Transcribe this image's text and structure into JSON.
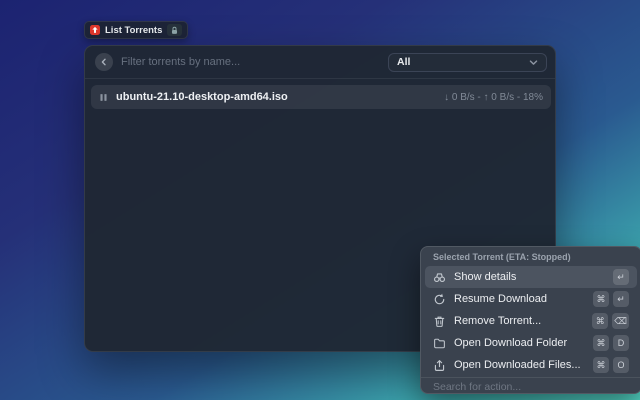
{
  "colors": {
    "background_gradient": [
      "#1c2371",
      "#253078",
      "#2a5a90",
      "#54dac9"
    ],
    "window_bg": "#1f2734",
    "action_panel_bg": "#3a424e",
    "selected_action_bg": "#4c5460",
    "row_highlight": "#343c4b",
    "app_icon_red": "#e0382d"
  },
  "command_badge": {
    "label": "List Torrents",
    "app_icon": "transmission-icon",
    "lock_icon": "lock-icon"
  },
  "window": {
    "header": {
      "back_icon": "chevron-left-icon",
      "filter_placeholder": "Filter torrents by name...",
      "status_dropdown": {
        "value": "All",
        "chevron_icon": "chevron-down-icon"
      }
    },
    "torrent_row": {
      "status_icon": "pause-icon",
      "name": "ubuntu-21.10-desktop-amd64.iso",
      "stats": "↓ 0 B/s - ↑ 0 B/s - 18%",
      "download_speed": "0 B/s",
      "upload_speed": "0 B/s",
      "progress": "18%"
    }
  },
  "action_panel": {
    "title": "Selected Torrent (ETA: Stopped)",
    "items": [
      {
        "icon": "binoculars-icon",
        "label": "Show details",
        "shortcuts": [
          "↵"
        ],
        "selected": true
      },
      {
        "icon": "resume-icon",
        "label": "Resume Download",
        "shortcuts": [
          "⌘",
          "↵"
        ],
        "selected": false
      },
      {
        "icon": "trash-icon",
        "label": "Remove Torrent...",
        "shortcuts": [
          "⌘",
          "⌫"
        ],
        "selected": false
      },
      {
        "icon": "folder-icon",
        "label": "Open Download Folder",
        "shortcuts": [
          "⌘",
          "D"
        ],
        "selected": false
      },
      {
        "icon": "open-files-icon",
        "label": "Open Downloaded Files...",
        "shortcuts": [
          "⌘",
          "O"
        ],
        "selected": false
      }
    ],
    "search_placeholder": "Search for action..."
  }
}
